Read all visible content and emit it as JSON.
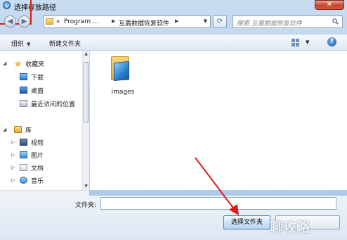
{
  "window": {
    "title": "选择存放路径",
    "close_label": "✕"
  },
  "nav": {
    "back_icon": "back-arrow-icon",
    "forward_icon": "forward-arrow-icon",
    "breadcrumb": [
      "«",
      "Program ...",
      "互盾数据恢复软件"
    ],
    "search_placeholder": "搜索 互盾数据恢复软件"
  },
  "toolbar": {
    "organize_label": "组织",
    "new_folder_label": "新建文件夹"
  },
  "sidebar": {
    "favorites_label": "收藏夹",
    "favorites": [
      "下载",
      "桌面",
      "最近访问的位置"
    ],
    "library_label": "库",
    "library": [
      "视频",
      "图片",
      "文档",
      "音乐"
    ]
  },
  "content": {
    "items": [
      {
        "name": "images",
        "type": "folder"
      }
    ]
  },
  "footer": {
    "folder_label": "文件夹:",
    "folder_value": "",
    "select_button_label": "选择文件夹",
    "cancel_button_label": ""
  },
  "watermark": {
    "text": "聊攻略"
  },
  "colors": {
    "annotation_red": "#e01a1a",
    "accent": "#3c7fb1"
  }
}
